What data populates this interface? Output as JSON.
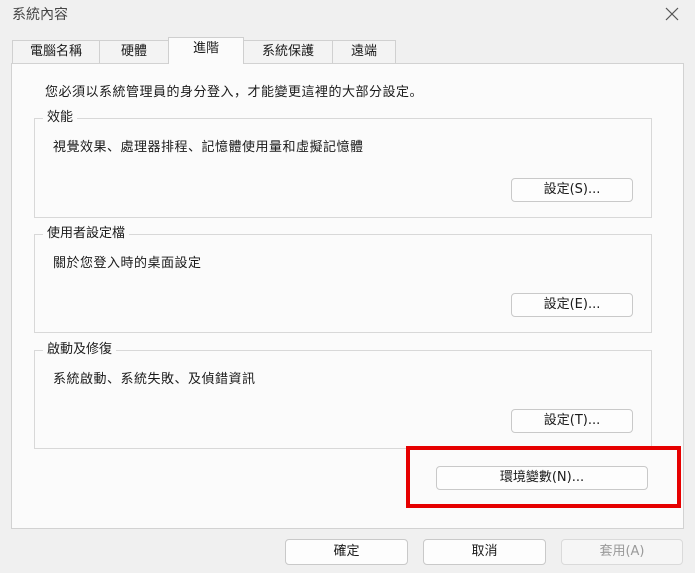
{
  "window": {
    "title": "系統內容"
  },
  "tabs": [
    {
      "label": "電腦名稱"
    },
    {
      "label": "硬體"
    },
    {
      "label": "進階"
    },
    {
      "label": "系統保護"
    },
    {
      "label": "遠端"
    }
  ],
  "active_tab": "進階",
  "intro": "您必須以系統管理員的身分登入，才能變更這裡的大部分設定。",
  "groups": {
    "performance": {
      "title": "效能",
      "desc": "視覺效果、處理器排程、記憶體使用量和虛擬記憶體",
      "button": "設定(S)..."
    },
    "profiles": {
      "title": "使用者設定檔",
      "desc": "關於您登入時的桌面設定",
      "button": "設定(E)..."
    },
    "startup": {
      "title": "啟動及修復",
      "desc": "系統啟動、系統失敗、及偵錯資訊",
      "button": "設定(T)..."
    }
  },
  "env_button": "環境變數(N)...",
  "footer": {
    "ok": "確定",
    "cancel": "取消",
    "apply": "套用(A)"
  },
  "colors": {
    "highlight": "#e60000",
    "background": "#f0f0f0",
    "panel": "#fbfbfb"
  }
}
